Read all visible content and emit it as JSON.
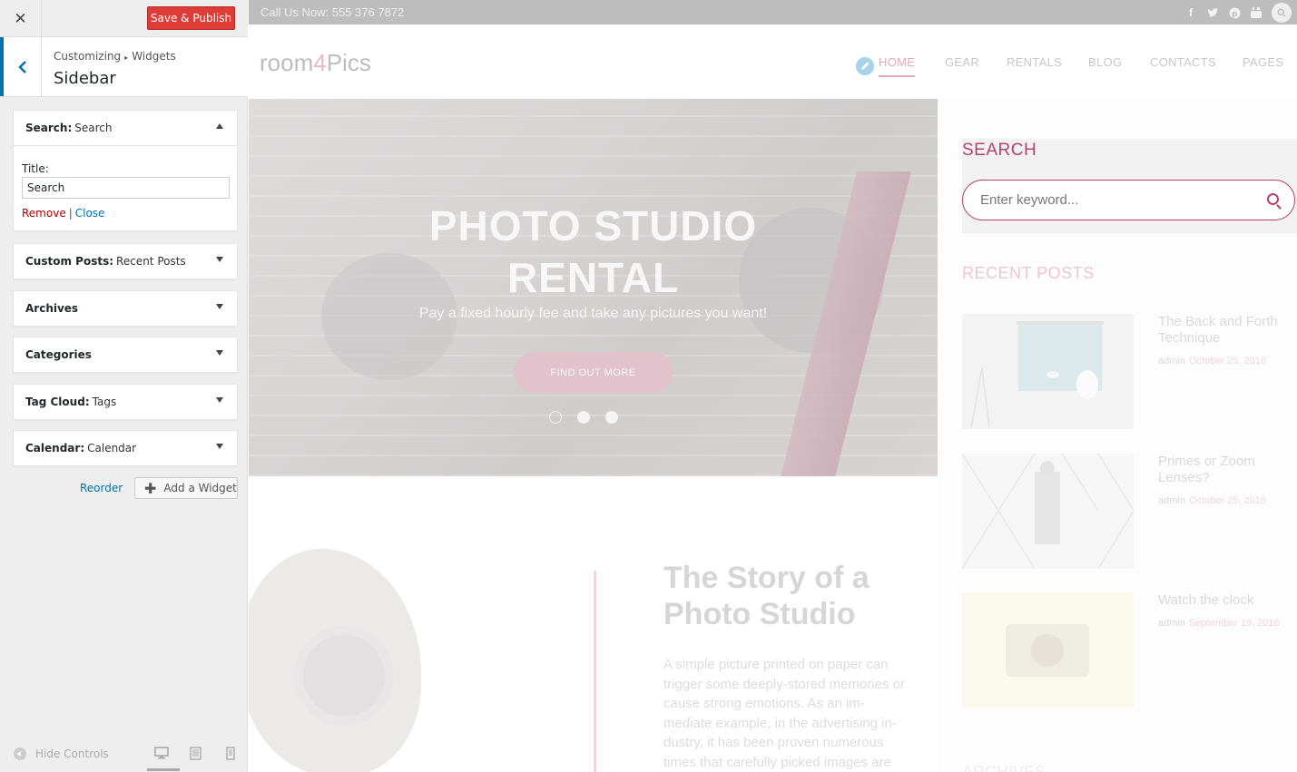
{
  "customizer": {
    "close_label": "✕",
    "publish_label": "Save & Publish",
    "breadcrumb": {
      "parent": "Customizing",
      "child": "Widgets"
    },
    "section_title": "Sidebar",
    "widgets": [
      {
        "type": "Search",
        "title": "Search",
        "expanded": true
      },
      {
        "type": "Custom Posts",
        "title": "Recent Posts",
        "expanded": false
      },
      {
        "type": "Archives",
        "title": "",
        "expanded": false
      },
      {
        "type": "Categories",
        "title": "",
        "expanded": false
      },
      {
        "type": "Tag Cloud",
        "title": "Tags",
        "expanded": false
      },
      {
        "type": "Calendar",
        "title": "Calendar",
        "expanded": false
      }
    ],
    "search_form": {
      "title_label": "Title:",
      "title_value": "Search",
      "remove": "Remove",
      "separator": "|",
      "close": "Close"
    },
    "reorder_label": "Reorder",
    "add_widget_label": "Add a Widget",
    "hide_controls_label": "Hide Controls",
    "accent_color": "#0073aa",
    "publish_color": "#dd3d36"
  },
  "preview": {
    "phone": "Call Us Now: 555 376 7872",
    "social_icons": [
      "facebook-icon",
      "twitter-icon",
      "pinterest-icon",
      "youtube-icon",
      "search-icon"
    ],
    "logo": {
      "part1": "room",
      "part2": "4",
      "part3": "Pics"
    },
    "nav": [
      "HOME",
      "GEAR",
      "RENTALS",
      "BLOG",
      "CONTACTS",
      "PAGES"
    ],
    "hero": {
      "title_line1": "PHOTO STUDIO",
      "title_line2": "RENTAL",
      "subtitle": "Pay a fixed hourly fee and take any pictures you want!",
      "button": "FIND OUT MORE"
    },
    "story": {
      "title": "The Story of a Photo Studio",
      "text": "A simple picture printed on paper can trigger some deeply-stored memories or cause strong emotions. As an im-mediate example, in the advertising in-dustry, it has been proven numerous times that carefully picked images are"
    },
    "sidebar": {
      "search_title": "SEARCH",
      "search_placeholder": "Enter keyword...",
      "recent_title": "RECENT POSTS",
      "posts": [
        {
          "title": "The Back and Forth Technique",
          "author": "admin",
          "date": "October 25, 2016"
        },
        {
          "title": "Primes or Zoom Lenses?",
          "author": "admin",
          "date": "October 25, 2016"
        },
        {
          "title": "Watch the clock",
          "author": "admin",
          "date": "September 19, 2016"
        }
      ],
      "archives_title": "ARCHIVES"
    },
    "brand_color": "#b5426e"
  }
}
